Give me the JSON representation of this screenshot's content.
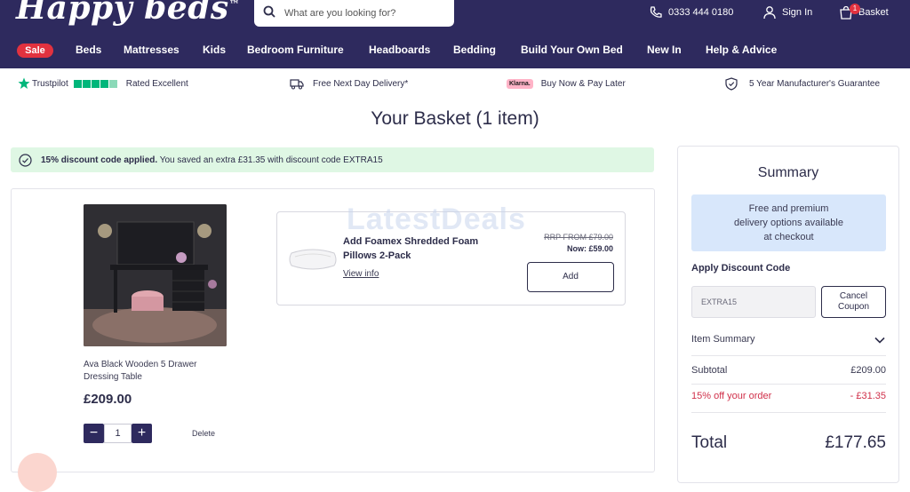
{
  "header": {
    "logo": "Happy beds",
    "search_placeholder": "What are you looking for?",
    "phone": "0333 444 0180",
    "signin": "Sign In",
    "basket": "Basket",
    "basket_count": "1"
  },
  "nav": {
    "items": [
      "Sale",
      "Beds",
      "Mattresses",
      "Kids",
      "Bedroom Furniture",
      "Headboards",
      "Bedding",
      "Build Your Own Bed",
      "New In",
      "Help & Advice"
    ]
  },
  "usp": {
    "trustpilot": "Trustpilot",
    "rated": "Rated Excellent",
    "delivery": "Free Next Day Delivery*",
    "klarna_logo": "Klarna.",
    "buy_now": "Buy Now & Pay Later",
    "guarantee": "5 Year Manufacturer's Guarantee"
  },
  "page": {
    "title": "Your Basket (1 item)",
    "discount_strong": "15% discount code applied.",
    "discount_rest": " You saved an extra £31.35 with discount code EXTRA15"
  },
  "product": {
    "name": "Ava Black Wooden 5 Drawer Dressing Table",
    "price": "£209.00",
    "quantity": "1",
    "delete": "Delete"
  },
  "upsell": {
    "title": "Add Foamex Shredded Foam Pillows 2-Pack",
    "view_info": "View info",
    "rrp": "RRP FROM £79.00",
    "now": "Now: £59.00",
    "add": "Add"
  },
  "summary": {
    "title": "Summary",
    "delivery_lines": [
      "Free and premium",
      "delivery options available",
      "at checkout"
    ],
    "apply_label": "Apply Discount Code",
    "coupon_value": "EXTRA15",
    "cancel_lines": [
      "Cancel",
      "Coupon"
    ],
    "item_summary": "Item Summary",
    "subtotal_label": "Subtotal",
    "subtotal_value": "£209.00",
    "discount_label": "15% off your order",
    "discount_value": "- £31.35",
    "total_label": "Total",
    "total_value": "£177.65"
  },
  "watermark": "LatestDeals",
  "colors": {
    "brand_navy": "#2e2a5e",
    "sale_red": "#e2323f",
    "discount_green_bg": "#dff7e4",
    "delivery_blue_bg": "#d8e7fb",
    "discount_text_red": "#d0304a",
    "trustpilot_green": "#00b67a",
    "klarna_pink": "#ffb3c7"
  }
}
